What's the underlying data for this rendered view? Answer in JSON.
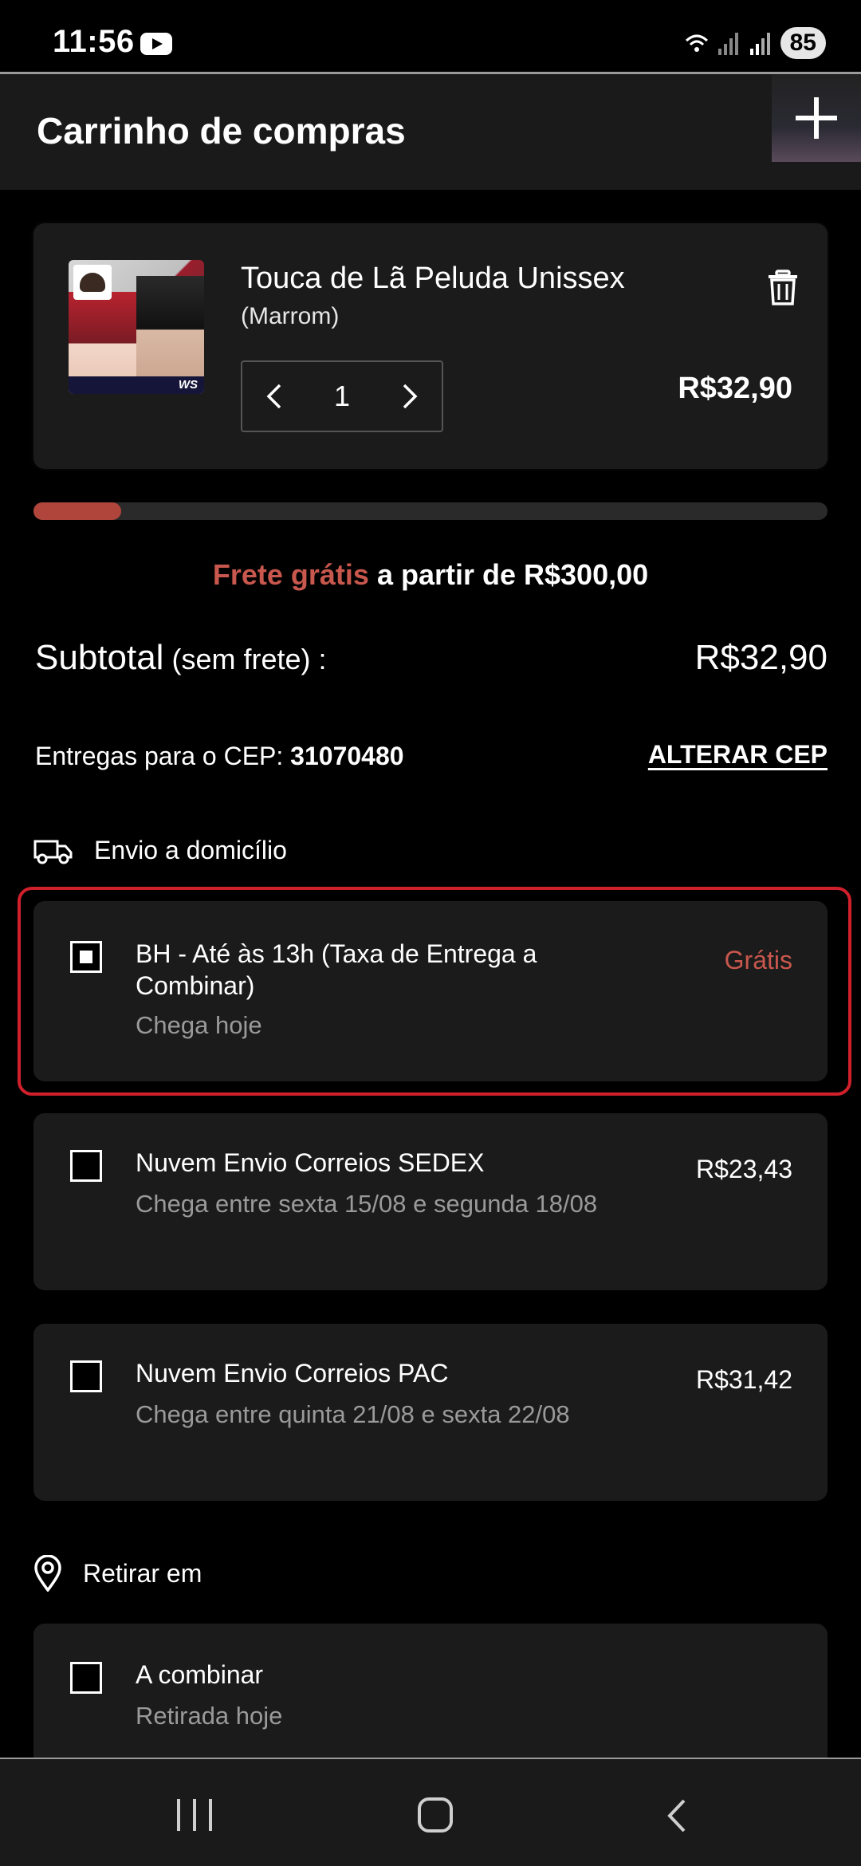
{
  "status_bar": {
    "time": "11:56",
    "battery": "85",
    "icons": [
      "youtube-icon",
      "wifi-icon",
      "signal-icon",
      "signal-icon-2"
    ]
  },
  "header": {
    "title": "Carrinho de compras",
    "action_icon": "plus-icon"
  },
  "cart": {
    "item": {
      "name": "Touca de Lã Peluda Unissex",
      "variant": "(Marrom)",
      "quantity": "1",
      "price": "R$32,90",
      "delete_icon": "trash-icon"
    }
  },
  "free_shipping": {
    "progress": 0.11,
    "accent": "Frete grátis",
    "rest": " a partir de R$300,00"
  },
  "subtotal": {
    "label": "Subtotal",
    "note": " (sem frete) :",
    "value": "R$32,90"
  },
  "cep": {
    "label": "Entregas para o CEP: ",
    "value": "31070480",
    "change_label": "ALTERAR CEP"
  },
  "home_delivery": {
    "heading": "Envio a domicílio",
    "icon": "truck-icon",
    "options": [
      {
        "title": "BH - Até às 13h (Taxa de Entrega a Combinar)",
        "subtitle": "Chega hoje",
        "price": "Grátis",
        "selected": true
      },
      {
        "title": "Nuvem Envio Correios SEDEX",
        "subtitle": "Chega entre sexta 15/08 e segunda 18/08",
        "price": "R$23,43",
        "selected": false
      },
      {
        "title": "Nuvem Envio Correios PAC",
        "subtitle": "Chega entre quinta 21/08 e sexta 22/08",
        "price": "R$31,42",
        "selected": false
      }
    ]
  },
  "pickup": {
    "heading": "Retirar em",
    "icon": "location-pin-icon",
    "options": [
      {
        "title": "A combinar",
        "subtitle": "Retirada hoje",
        "selected": false
      }
    ]
  },
  "colors": {
    "accent": "#c8574d",
    "highlight": "#d0202c",
    "background": "#000000",
    "card": "#1b1b1b"
  },
  "nav": {
    "icons": [
      "recent-apps-icon",
      "home-icon",
      "back-icon"
    ]
  }
}
